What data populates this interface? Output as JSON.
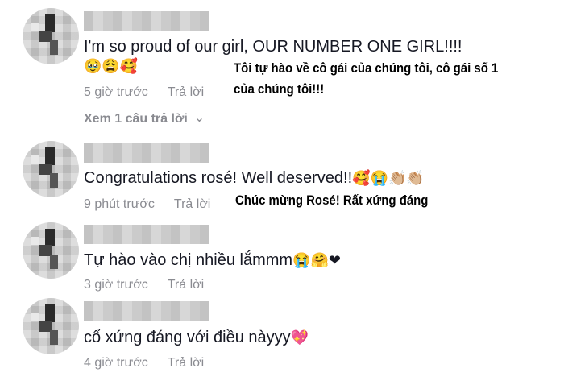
{
  "comments": [
    {
      "text": "I'm so proud of our girl, OUR NUMBER ONE GIRL!!!!",
      "emojis": "🥹😩🥰",
      "time": "5 giờ trước",
      "reply": "Trả lời",
      "view_replies": "Xem 1 câu trả lời",
      "translation_line1": "Tôi tự hào về cô gái của chúng tôi, cô gái số 1",
      "translation_line2": "của chúng tôi!!!"
    },
    {
      "text": "Congratulations rosé! Well deserved!!",
      "emojis": "🥰😭👏🏼👏🏼",
      "time": "9 phút trước",
      "reply": "Trả lời",
      "translation_line1": "Chúc mừng Rosé! Rất xứng đáng"
    },
    {
      "text": "Tự hào vào chị nhiều lắmmm",
      "emojis": "😭🤗❤",
      "time": "3 giờ trước",
      "reply": "Trả lời"
    },
    {
      "text": "cổ xứng đáng với điều nàyyy",
      "emojis": "💖",
      "time": "4 giờ trước",
      "reply": "Trả lời"
    }
  ],
  "icons": {
    "chevron": "chevron-down-icon",
    "avatar": "blurred-avatar"
  },
  "colors": {
    "text": "#161823",
    "meta": "#8a8b91"
  }
}
